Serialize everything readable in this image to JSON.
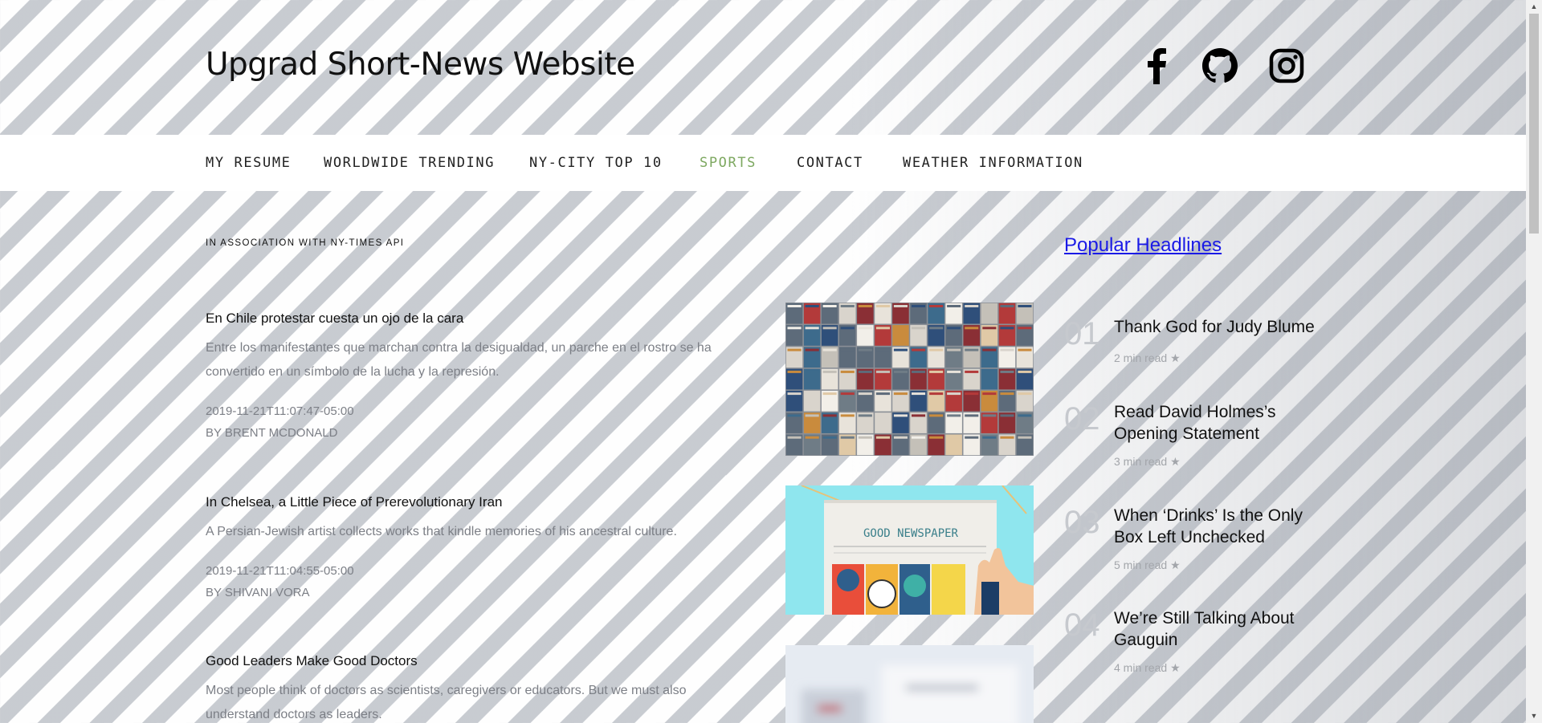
{
  "header": {
    "title": "Upgrad Short-News Website",
    "social_icons": [
      "facebook-icon",
      "github-icon",
      "instagram-icon"
    ]
  },
  "nav": {
    "items": [
      {
        "label": "MY RESUME"
      },
      {
        "label": "WORLDWIDE TRENDING"
      },
      {
        "label": "NY-CITY TOP 10"
      },
      {
        "label": "SPORTS",
        "active": true
      },
      {
        "label": "CONTACT"
      },
      {
        "label": "WEATHER INFORMATION"
      }
    ],
    "active_color": "#7da860"
  },
  "main": {
    "association": "IN ASSOCIATION WITH NY-TIMES API",
    "articles": [
      {
        "title": "En Chile protestar cuesta un ojo de la cara",
        "abstract": "Entre los manifestantes que marchan contra la desigualdad, un parche en el rostro se ha convertido en un símbolo de la lucha y la represión.",
        "date": "2019-11-21T11:07:47-05:00",
        "byline": "BY BRENT MCDONALD",
        "thumbnail": "newspaper-rack-image"
      },
      {
        "title": "In Chelsea, a Little Piece of Prerevolutionary Iran",
        "abstract": "A Persian-Jewish artist collects works that kindle memories of his ancestral culture.",
        "date": "2019-11-21T11:04:55-05:00",
        "byline": "BY SHIVANI VORA",
        "thumbnail": "good-newspaper-illustration",
        "thumbnail_text": "GOOD NEWSPAPER"
      },
      {
        "title": "Good Leaders Make Good Doctors",
        "abstract": "Most people think of doctors as scientists, caregivers or educators. But we must also understand doctors as leaders.",
        "thumbnail": "blurred-papers-image"
      }
    ]
  },
  "sidebar": {
    "heading": "Popular Headlines",
    "heading_color": "#1a1ae6",
    "items": [
      {
        "num": "01",
        "title": "Thank God for Judy Blume",
        "meta": "2 min read"
      },
      {
        "num": "02",
        "title": "Read David Holmes’s Opening Statement",
        "meta": "3 min read"
      },
      {
        "num": "03",
        "title": "When ‘Drinks’ Is the Only Box Left Unchecked",
        "meta": "5 min read"
      },
      {
        "num": "04",
        "title": "We’re Still Talking About Gauguin",
        "meta": "4 min read"
      }
    ]
  },
  "colors": {
    "meta_text": "#7c7f86",
    "nav_background": "#ffffff"
  }
}
